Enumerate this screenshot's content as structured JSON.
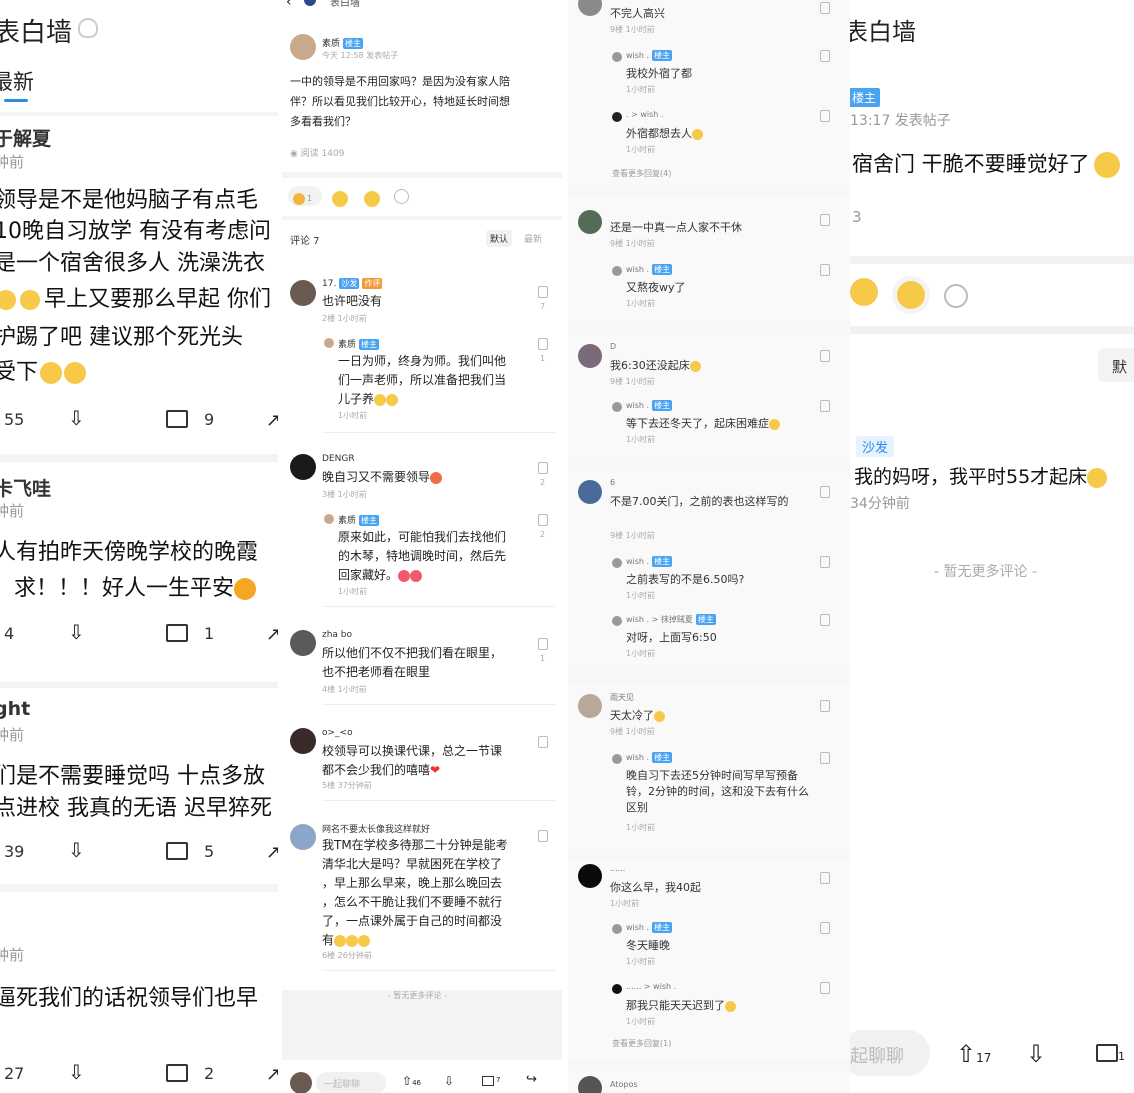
{
  "panel1": {
    "title": "表白墙",
    "tab": "最新",
    "posts": [
      {
        "author": "于解夏",
        "time": "钟前",
        "lines": [
          "领导是不是他妈脑子有点毛",
          "10晚自习放学 有没有考虑问",
          "是一个宿舍很多人 洗澡洗衣",
          "早上又要那么早起 你们",
          "护踢了吧 建议那个死光头",
          "受下"
        ],
        "likes": "55",
        "comments": "9"
      },
      {
        "author": "卡飞哇",
        "time": "钟前",
        "lines": [
          "人有拍昨天傍晚学校的晚霞",
          "求！！！好人一生平安"
        ],
        "likes": "4",
        "comments": "1"
      },
      {
        "author": "ght",
        "time": "钟前",
        "lines": [
          "们是不需要睡觉吗 十点多放",
          "点进校 我真的无语 迟早猝死"
        ],
        "likes": "39",
        "comments": "5"
      },
      {
        "author": "",
        "time": "钟前",
        "lines": [
          "逼死我们的话祝领导们也早"
        ],
        "likes": "27",
        "comments": "2"
      }
    ]
  },
  "panel2": {
    "header": "表白墙",
    "op_name": "素质",
    "op_badge": "楼主",
    "op_time": "今天 12:58 发表帖子",
    "op_text": [
      "一中的领导是不用回家吗？是因为没有家人陪",
      "伴？所以看见我们比较开心，特地延长时间想",
      "多看看我们？"
    ],
    "reads": "阅读 1409",
    "reaction_count": "1",
    "comments_label": "评论 7",
    "sort_default": "默认",
    "sort_latest": "最新",
    "comments": [
      {
        "name": "17.",
        "badge1": "沙发",
        "badge2": "作评",
        "text": [
          "也许吧没有"
        ],
        "meta": "2楼 1小时前",
        "likes": "7",
        "reply": {
          "name": "素质",
          "badge": "楼主",
          "text": [
            "一日为师，终身为师。我们叫他",
            "们一声老师，所以准备把我们当",
            "儿子养"
          ],
          "meta": "1小时前",
          "likes": "1"
        }
      },
      {
        "name": "DENGR",
        "text": [
          "晚自习又不需要领导"
        ],
        "meta": "3楼 1小时前",
        "likes": "2",
        "reply": {
          "name": "素质",
          "badge": "楼主",
          "text": [
            "原来如此，可能怕我们去找他们",
            "的木琴，特地调晚时间，然后先",
            "回家藏好。"
          ],
          "meta": "1小时前",
          "likes": "2"
        }
      },
      {
        "name": "zha bo",
        "text": [
          "所以他们不仅不把我们看在眼里，",
          "也不把老师看在眼里"
        ],
        "meta": "4楼 1小时前",
        "likes": "1"
      },
      {
        "name": "o>_<o",
        "text": [
          "校领导可以换课代课，总之一节课",
          "都不会少我们的嘻嘻"
        ],
        "meta": "5楼 37分钟前",
        "likes": ""
      },
      {
        "name": "网名不要太长像我这样就好",
        "text": [
          "我TM在学校多待那二十分钟是能考",
          "清华北大是吗？早就困死在学校了",
          "，早上那么早来，晚上那么晚回去",
          "，怎么不干脆让我们不要睡不就行",
          "了，一点课外属于自己的时间都没",
          "有"
        ],
        "meta": "6楼 26分钟前",
        "likes": ""
      }
    ],
    "no_more": "- 暂无更多评论 -",
    "input_placeholder": "一起聊聊",
    "bar_up": "46",
    "bar_comments": "7"
  },
  "panel3": {
    "items": [
      {
        "name": "",
        "text": "不完人高兴",
        "meta": "9楼 1小时前"
      },
      {
        "name": "wish .",
        "badge": "楼主",
        "text": "我校外宿了都",
        "meta": "1小时前"
      },
      {
        "name": ". > wish .",
        "text": "外宿都想去人",
        "meta": "1小时前"
      },
      {
        "name": "",
        "text": "查看更多回复(4)",
        "meta": ""
      },
      {
        "name": "",
        "text": "还是一中真一点人家不干休",
        "meta": "9楼 1小时前"
      },
      {
        "name": "wish .",
        "badge": "楼主",
        "text": "又熬夜wy了",
        "meta": "1小时前"
      },
      {
        "name": "D",
        "text": "我6:30还没起床",
        "meta": "9楼 1小时前"
      },
      {
        "name": "wish .",
        "badge": "楼主",
        "text": "等下去还冬天了，起床困难症",
        "meta": "1小时前"
      },
      {
        "name": "6",
        "text": "不是7.00关门，之前的表也这样写的",
        "meta": "9楼 1小时前"
      },
      {
        "name": "wish .",
        "badge": "楼主",
        "text": "之前表写的不是6.50吗?",
        "meta": "1小时前"
      },
      {
        "name": "wish . > 抹掉贼夏",
        "badge": "楼主",
        "text": "对呀，上面写6:50",
        "meta": "1小时前"
      },
      {
        "name": "雨天见",
        "text": "天太冷了",
        "meta": "9楼 1小时前"
      },
      {
        "name": "wish .",
        "badge": "楼主",
        "text": "晚自习下去还5分钟时间写早写预备铃，2分钟的时间，这和没下去有什么区别",
        "meta": "1小时前"
      },
      {
        "name": "......",
        "text": "你这么早，我40起",
        "meta": "1小时前"
      },
      {
        "name": "wish .",
        "badge": "楼主",
        "text": "冬天睡晚",
        "meta": "1小时前"
      },
      {
        "name": "...... > wish .",
        "text": "那我只能天天迟到了",
        "meta": "1小时前"
      },
      {
        "name": "",
        "text": "查看更多回复(1)",
        "meta": ""
      },
      {
        "name": "Atopos",
        "text": "",
        "meta": ""
      }
    ]
  },
  "panel4": {
    "title": "表白墙",
    "op_badge": "楼主",
    "op_time": "13:17 发表帖子",
    "op_text": "宿舍门 干脆不要睡觉好了",
    "reads": "3",
    "sort_default": "默",
    "comment_badge": "沙发",
    "comment_text": "我的妈呀，我平时55才起床",
    "comment_time": "34分钟前",
    "no_more": "- 暂无更多评论 -",
    "input_placeholder": "起聊聊",
    "up_count": "17",
    "comments": "1"
  }
}
